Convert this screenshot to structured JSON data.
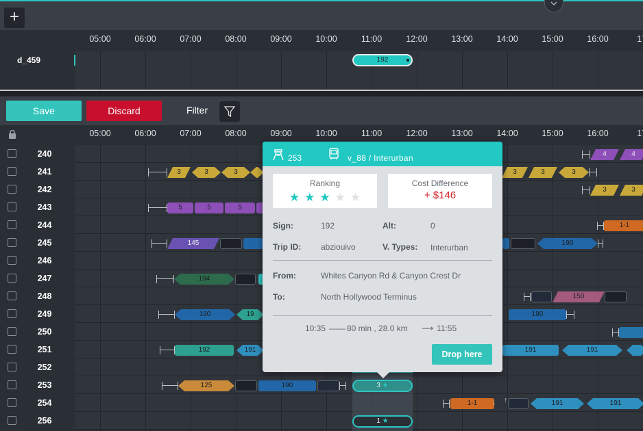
{
  "top": {
    "add_label": "+",
    "collapse_icon": "chevron-down-icon",
    "hours": [
      "05:00",
      "06:00",
      "07:00",
      "08:00",
      "09:00",
      "10:00",
      "11:00",
      "12:00",
      "13:00",
      "14:00",
      "15:00",
      "16:00",
      "17:"
    ],
    "driver_label": "d_459",
    "driver_trip_label": "192"
  },
  "toolbar": {
    "save_label": "Save",
    "discard_label": "Discard",
    "filter_label": "Filter"
  },
  "schedule": {
    "hours": [
      "05:00",
      "06:00",
      "07:00",
      "08:00",
      "09:00",
      "10:00",
      "11:00",
      "12:00",
      "13:00",
      "14:00",
      "15:00",
      "16:00",
      "17:"
    ],
    "rows": [
      "240",
      "241",
      "242",
      "243",
      "244",
      "245",
      "246",
      "247",
      "248",
      "249",
      "250",
      "251",
      "252",
      "253",
      "254",
      "256"
    ]
  },
  "trips": {
    "r240a": "4",
    "r240b": "4",
    "r241a": "3",
    "r241b": "3",
    "r241c": "3",
    "r241d": "3",
    "r241e": "3",
    "r241f": "3",
    "r242a": "3",
    "r242b": "3",
    "r243a": "5",
    "r243b": "5",
    "r243c": "5",
    "r244a": "1-1",
    "r245a": "145",
    "r245b": "190",
    "r247a": "194",
    "r248a": "150",
    "r249a": "190",
    "r249b": "19",
    "r249c": "190",
    "r251a": "192",
    "r251b": "191",
    "r251c": "191",
    "r251d": "191",
    "r253a": "125",
    "r253b": "190",
    "r253c": "3",
    "r254a": "1-1",
    "r254b": "191",
    "r254c": "191",
    "r256a": "1"
  },
  "popup": {
    "driver_id": "253",
    "vehicle": "v_88 / Interurban",
    "ranking_label": "Ranking",
    "ranking_stars": 3,
    "ranking_max": 5,
    "cost_label": "Cost Difference",
    "cost_value": "+ $146",
    "sign_label": "Sign:",
    "sign_value": "192",
    "alt_label": "Alt:",
    "alt_value": "0",
    "trip_id_label": "Trip ID:",
    "trip_id_value": "abziouivo",
    "vtypes_label": "V. Types:",
    "vtypes_value": "Interurban",
    "from_label": "From:",
    "from_value": "Whites Canyon Rd & Canyon Crest Dr",
    "to_label": "To:",
    "to_value": "North Hollywood Terminus",
    "start_time": "10:35",
    "duration": "80 min , 28.0 km",
    "end_time": "11:55",
    "drop_label": "Drop here"
  },
  "colors": {
    "teal": "#2ec4c0",
    "gold": "#c9a83a",
    "purple": "#8e4fb8",
    "violet": "#6a52b3",
    "orange": "#d06a23",
    "blue": "#2167a8",
    "green": "#2d7d6e",
    "mauve": "#a35a7c",
    "red": "#c8102e"
  }
}
